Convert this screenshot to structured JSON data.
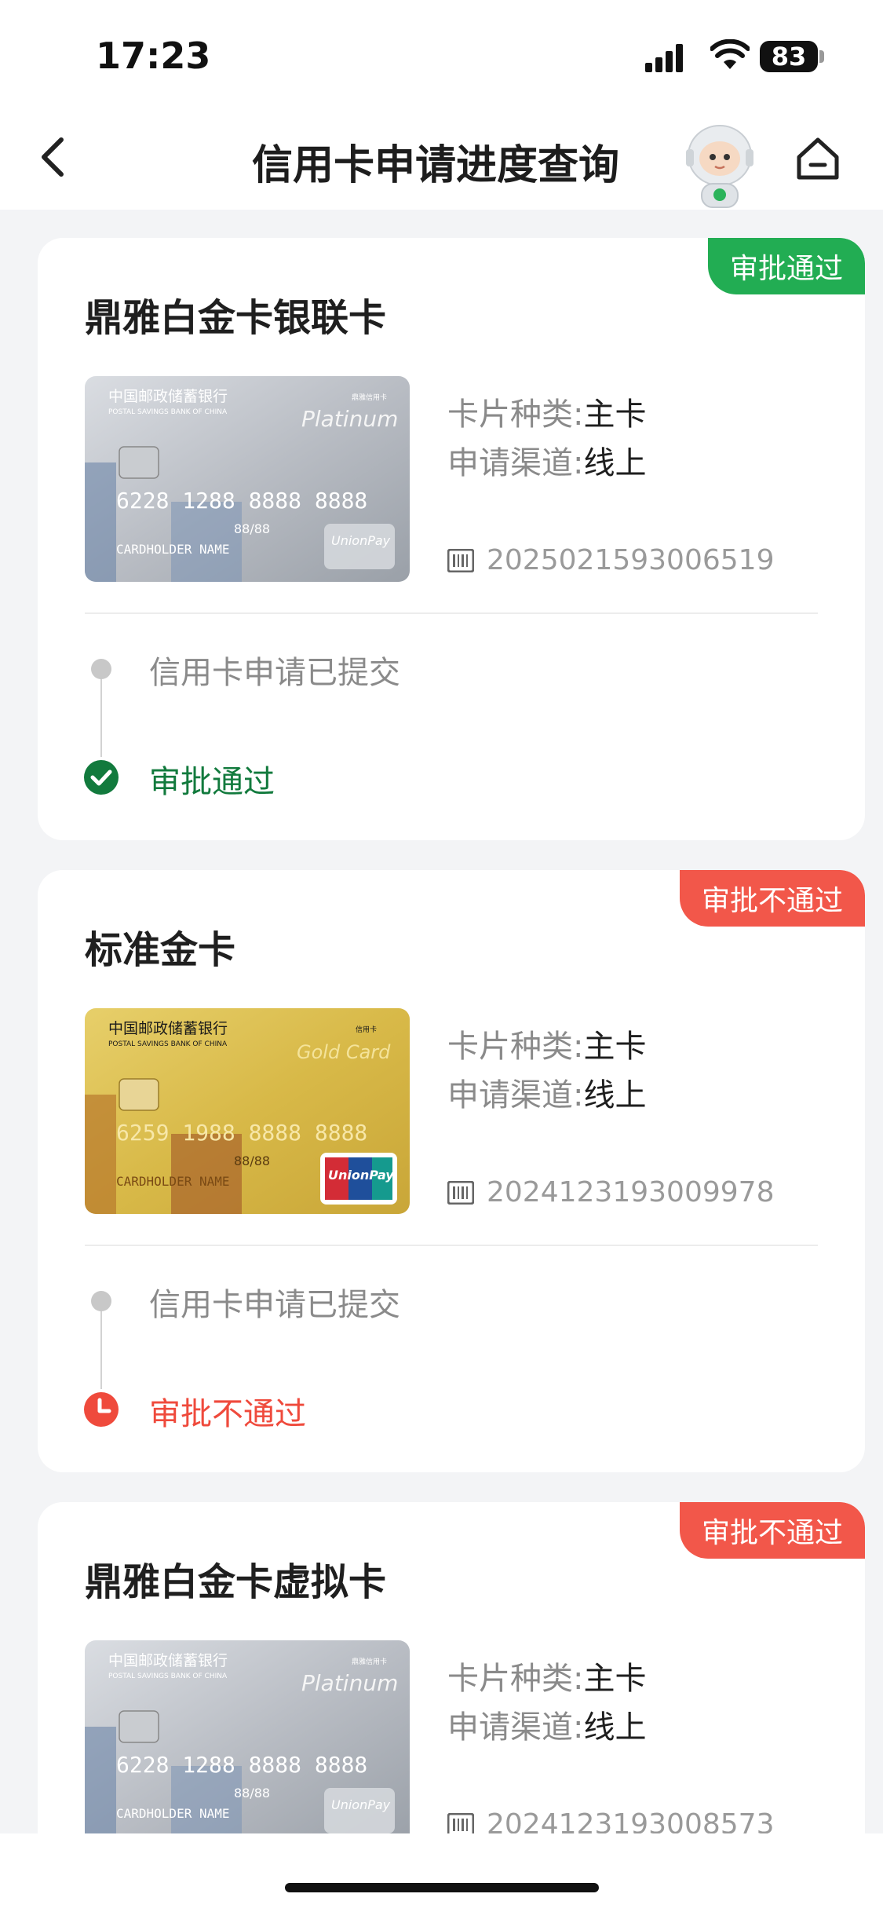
{
  "status_bar": {
    "time": "17:23",
    "battery": "83"
  },
  "nav": {
    "title": "信用卡申请进度查询"
  },
  "cards": [
    {
      "name": "鼎雅白金卡银联卡",
      "badge": "审批通过",
      "card_type_label": "卡片种类:",
      "card_type_value": "主卡",
      "channel_label": "申请渠道:",
      "channel_value": "线上",
      "application_no": "2025021593006519",
      "step1": "信用卡申请已提交",
      "step2": "审批通过",
      "card_face": {
        "bank_cn": "中国邮政储蓄银行",
        "bank_en": "POSTAL SAVINGS BANK OF CHINA",
        "series": "Platinum",
        "tag": "鼎雅信用卡",
        "number": "6228 1288 8888 8888",
        "holder": "CARDHOLDER NAME",
        "expiry": "88/88",
        "brand": "UnionPay"
      }
    },
    {
      "name": "标准金卡",
      "badge": "审批不通过",
      "card_type_label": "卡片种类:",
      "card_type_value": "主卡",
      "channel_label": "申请渠道:",
      "channel_value": "线上",
      "application_no": "2024123193009978",
      "step1": "信用卡申请已提交",
      "step2": "审批不通过",
      "card_face": {
        "bank_cn": "中国邮政储蓄银行",
        "bank_en": "POSTAL SAVINGS BANK OF CHINA",
        "series": "Gold Card",
        "tag": "信用卡",
        "number": "6259 1988 8888 8888",
        "holder": "CARDHOLDER NAME",
        "expiry": "88/88",
        "brand": "UnionPay"
      }
    },
    {
      "name": "鼎雅白金卡虚拟卡",
      "badge": "审批不通过",
      "card_type_label": "卡片种类:",
      "card_type_value": "主卡",
      "channel_label": "申请渠道:",
      "channel_value": "线上",
      "application_no": "2024123193008573",
      "card_face": {
        "bank_cn": "中国邮政储蓄银行",
        "bank_en": "POSTAL SAVINGS BANK OF CHINA",
        "series": "Platinum",
        "tag": "鼎雅信用卡",
        "number": "6228 1288 8888 8888",
        "holder": "CARDHOLDER NAME",
        "expiry": "88/88",
        "brand": "UnionPay"
      }
    }
  ],
  "colors": {
    "approved": "#22ad53",
    "rejected": "#f2574a",
    "approved_text": "#127a3d",
    "rejected_text": "#ef4a3c"
  },
  "icons": [
    "back-chevron-icon",
    "mascot-icon",
    "home-icon",
    "barcode-icon",
    "check-circle-icon",
    "clock-icon"
  ]
}
